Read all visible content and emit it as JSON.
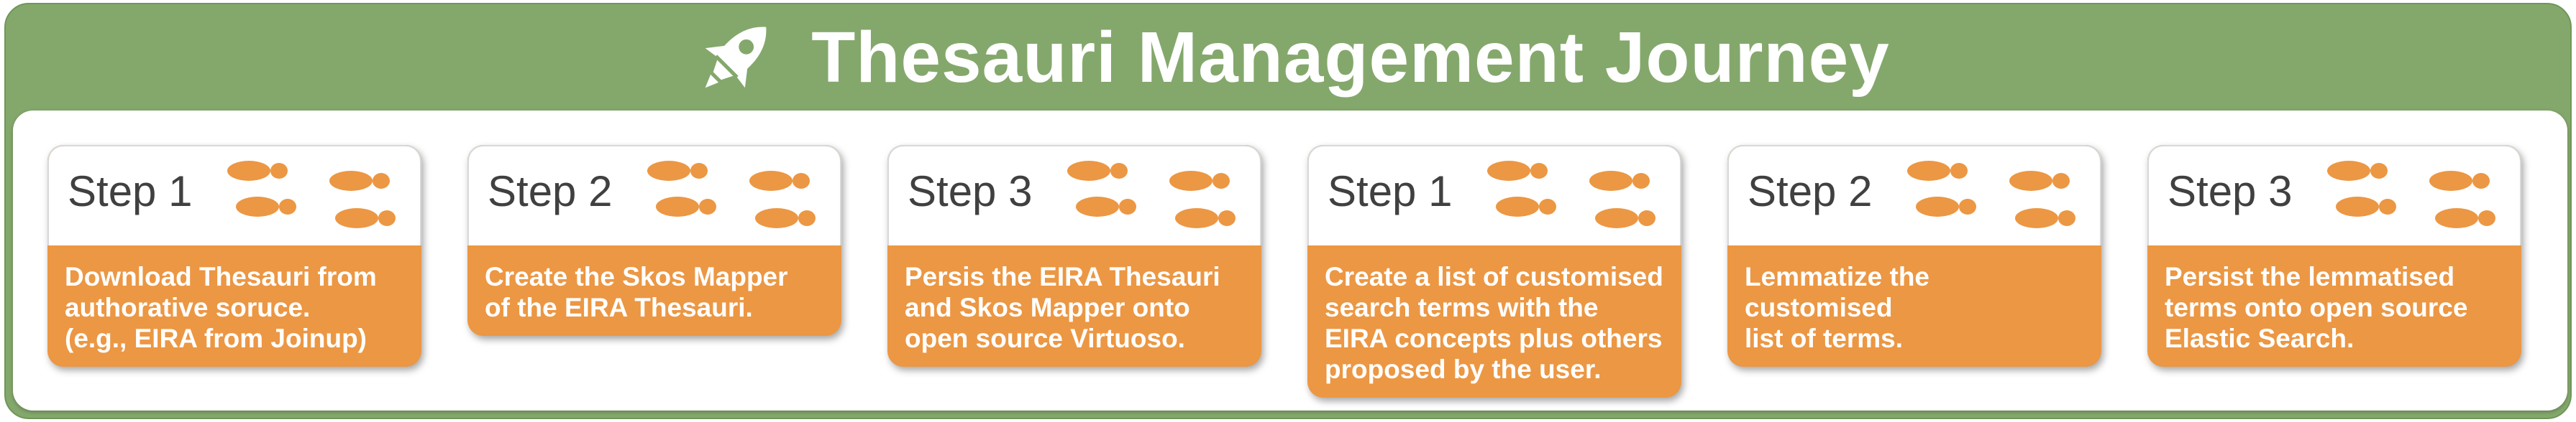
{
  "banner": {
    "title": "Thesauri Management Journey"
  },
  "steps": [
    {
      "label": "Step 1",
      "text": "Download Thesauri from\nauthorative soruce.\n(e.g., EIRA from Joinup)"
    },
    {
      "label": "Step 2",
      "text": "Create the Skos Mapper\nof the EIRA Thesauri."
    },
    {
      "label": "Step 3",
      "text": "Persis the EIRA Thesauri\nand Skos Mapper onto\nopen source Virtuoso."
    },
    {
      "label": "Step 1",
      "text": "Create a list of customised\nsearch terms with the\nEIRA concepts plus others\nproposed by the user."
    },
    {
      "label": "Step 2",
      "text": "Lemmatize the customised\nlist of terms."
    },
    {
      "label": "Step 3",
      "text": "Persist the lemmatised\nterms onto open source\nElastic Search."
    }
  ],
  "colors": {
    "banner": "#84a86c",
    "card": "#ec9743",
    "footprint": "#ec9743"
  },
  "icons": {
    "title": "rocket-icon",
    "step": "footprints-icon"
  }
}
